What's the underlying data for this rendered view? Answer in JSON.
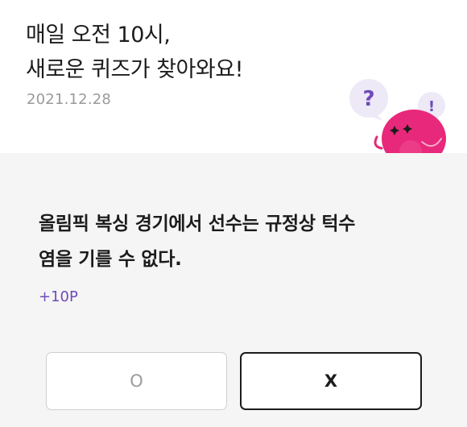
{
  "header": {
    "title_line1": "매일 오전 10시,",
    "title_line2": "새로운 퀴즈가 찾아와요!",
    "date": "2021.12.28"
  },
  "mascot": {
    "bubble_question": "?",
    "bubble_exclaim": "!",
    "body_color": "#e8287a",
    "bubble_color": "#ede9f7",
    "question_color": "#6f4bb8"
  },
  "quiz": {
    "question_line1": "올림픽 복싱 경기에서 선수는 규정상 턱수",
    "question_line2": "염을 기를 수 없다.",
    "points": "+10P",
    "answer_o_label": "O",
    "answer_x_label": "X"
  },
  "colors": {
    "panel_bg": "#f5f5f5",
    "accent": "#6f4bb8"
  }
}
